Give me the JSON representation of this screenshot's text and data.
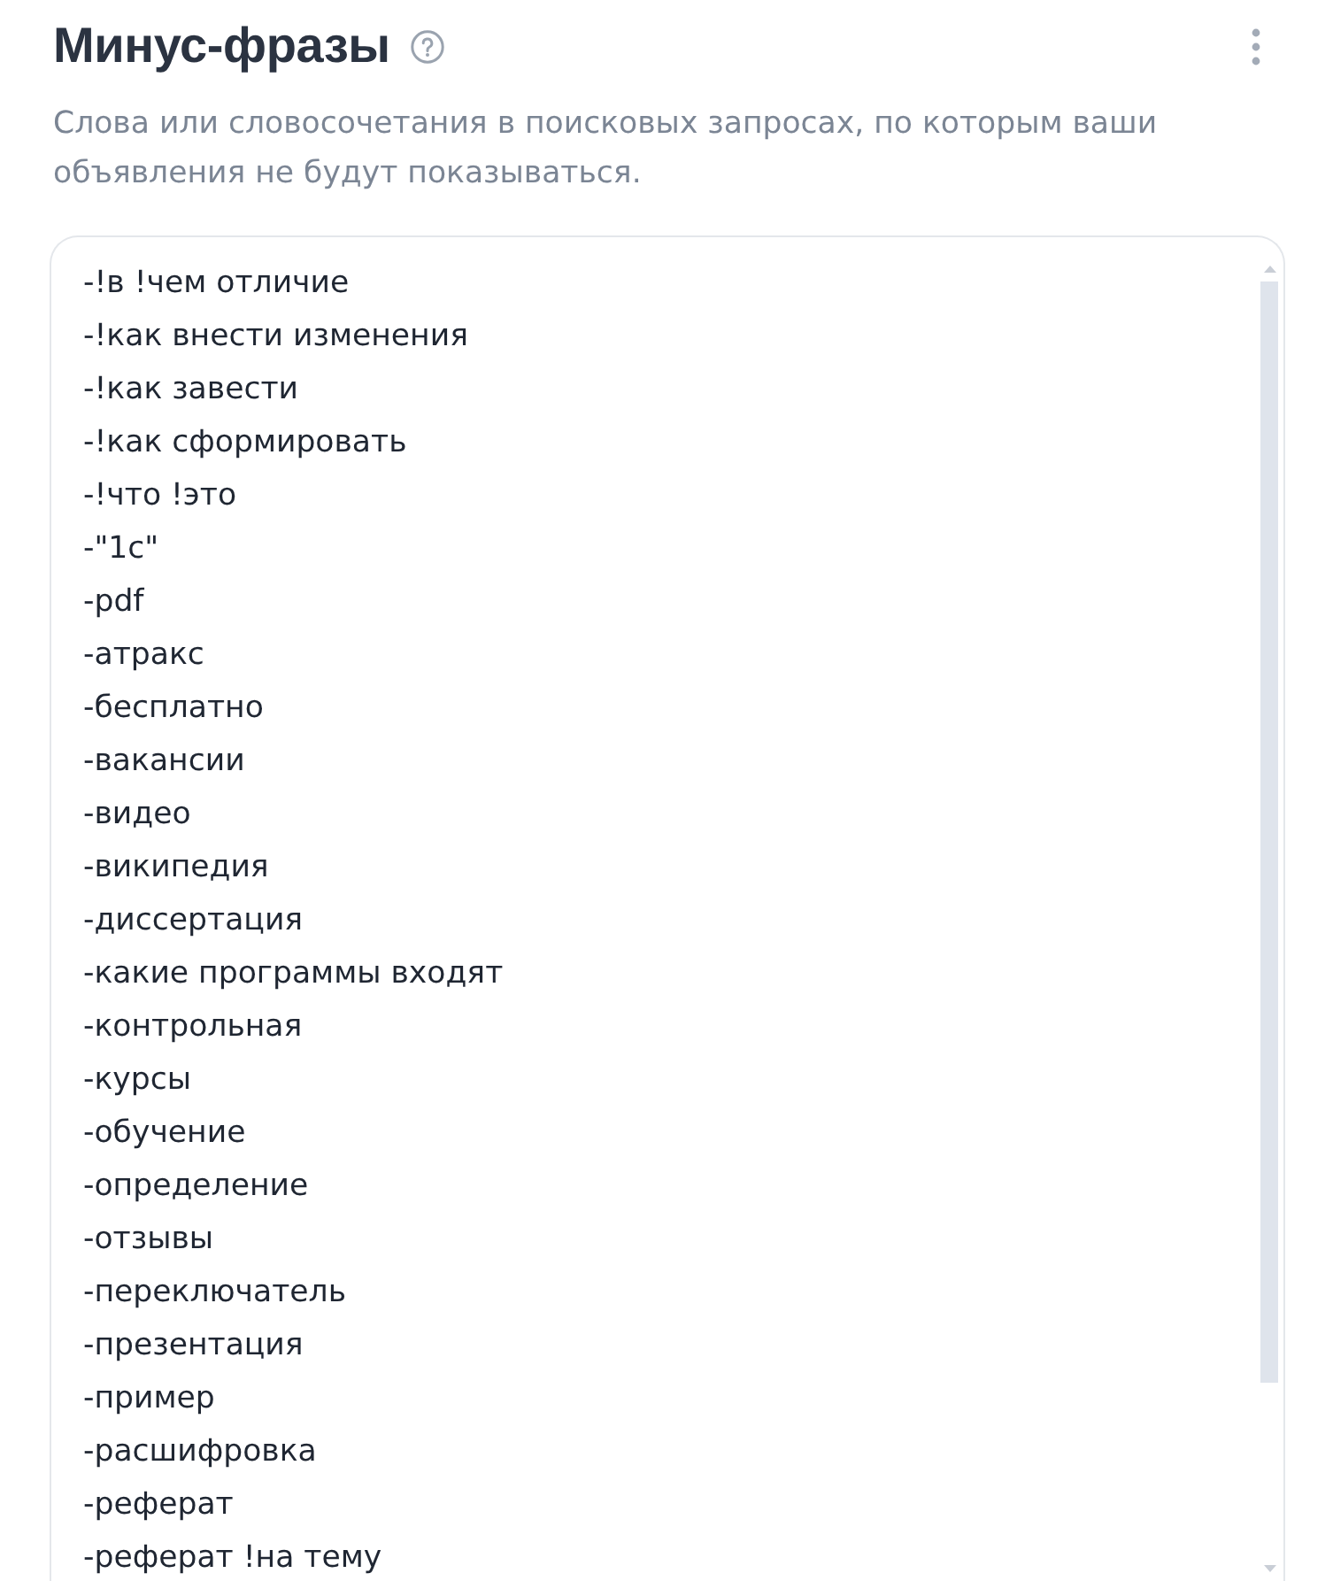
{
  "header": {
    "title": "Минус-фразы"
  },
  "description": "Слова или словосочетания в поисковых запросах, по которым ваши объявления не будут показываться.",
  "phrases_field": {
    "lines": [
      "-!в !чем отличие",
      "-!как внести изменения",
      "-!как завести",
      "-!как сформировать",
      "-!что !это",
      "-\"1с\"",
      "-pdf",
      "-атракс",
      "-бесплатно",
      "-вакансии",
      "-видео",
      "-википедия",
      "-диссертация",
      "-какие программы входят",
      "-контрольная",
      "-курсы",
      "-обучение",
      "-определение",
      "-отзывы",
      "-переключатель",
      "-презентация",
      "-пример",
      "-расшифровка",
      "-реферат",
      "-реферат !на тему"
    ]
  }
}
